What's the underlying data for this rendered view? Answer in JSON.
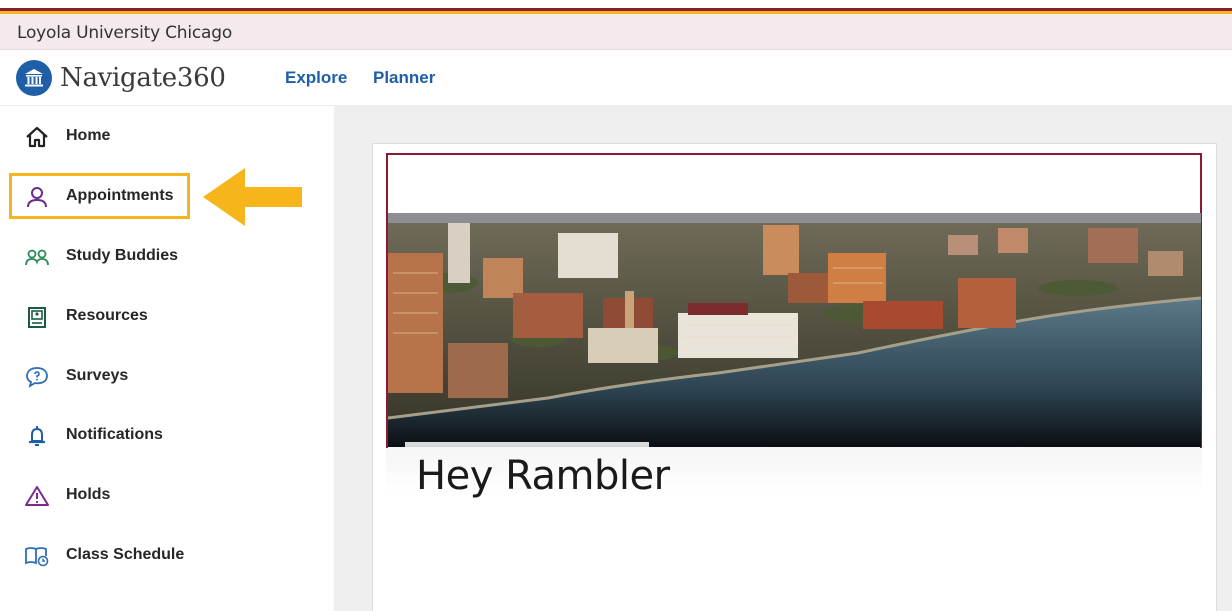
{
  "university": {
    "name": "Loyola University Chicago"
  },
  "brand": {
    "name": "Navigate360",
    "accent": "#1f5fa8",
    "maroon": "#8a1c32",
    "gold": "#f5b51b"
  },
  "topnav": [
    {
      "label": "Explore"
    },
    {
      "label": "Planner"
    }
  ],
  "sidebar": {
    "items": [
      {
        "label": "Home",
        "icon": "home-icon"
      },
      {
        "label": "Appointments",
        "icon": "person-icon"
      },
      {
        "label": "Study Buddies",
        "icon": "people-icon"
      },
      {
        "label": "Resources",
        "icon": "resources-icon"
      },
      {
        "label": "Surveys",
        "icon": "chat-question-icon"
      },
      {
        "label": "Notifications",
        "icon": "bell-icon"
      },
      {
        "label": "Holds",
        "icon": "warning-icon"
      },
      {
        "label": "Class Schedule",
        "icon": "book-clock-icon"
      }
    ],
    "highlighted": "Appointments"
  },
  "main": {
    "greeting": "Hey Rambler",
    "banner": "campus-lakefront-photo"
  }
}
